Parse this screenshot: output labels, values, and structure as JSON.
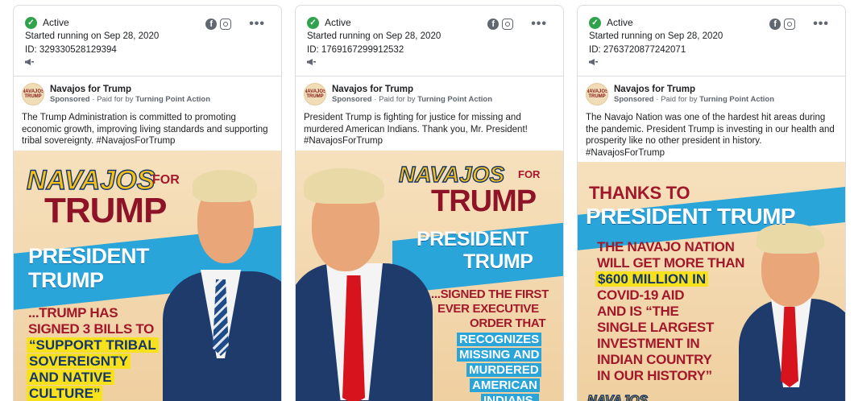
{
  "cards": [
    {
      "status": "Active",
      "started": "Started running on Sep 28, 2020",
      "id": "ID: 329330528129394",
      "page_name": "Navajos for Trump",
      "sponsored": "Sponsored",
      "paid_for_by": "Paid for by",
      "payer": "Turning Point Action",
      "ad_text": "The Trump Administration is committed to promoting economic growth, improving living standards and supporting tribal sovereignty. #NavajosForTrump",
      "creative": {
        "line1": "NAVAJOS",
        "line1b": "FOR",
        "line2": "TRUMP",
        "line3": "PRESIDENT",
        "line4": "TRUMP",
        "line5": "...TRUMP HAS",
        "line6": "SIGNED 3 BILLS TO",
        "line7": "“SUPPORT TRIBAL",
        "line8": "SOVEREIGNTY",
        "line9": "AND NATIVE",
        "line10": "CULTURE”"
      }
    },
    {
      "status": "Active",
      "started": "Started running on Sep 28, 2020",
      "id": "ID: 1769167299912532",
      "page_name": "Navajos for Trump",
      "sponsored": "Sponsored",
      "paid_for_by": "Paid for by",
      "payer": "Turning Point Action",
      "ad_text": "President Trump is fighting for justice for missing and murdered American Indians. Thank you, Mr. President! #NavajosForTrump",
      "creative": {
        "line1": "NAVAJOS",
        "line1b": "FOR",
        "line2": "TRUMP",
        "line3": "PRESIDENT",
        "line4": "TRUMP",
        "line5": "...SIGNED THE FIRST",
        "line6": "EVER EXECUTIVE",
        "line7": "ORDER THAT",
        "line8": "RECOGNIZES",
        "line9": "MISSING AND",
        "line10": "MURDERED",
        "line11": "AMERICAN",
        "line12": "INDIANS."
      }
    },
    {
      "status": "Active",
      "started": "Started running on Sep 28, 2020",
      "id": "ID: 2763720877242071",
      "page_name": "Navajos for Trump",
      "sponsored": "Sponsored",
      "paid_for_by": "Paid for by",
      "payer": "Turning Point Action",
      "ad_text": "The Navajo Nation was one of the hardest hit areas during the pandemic. President Trump is investing in our health and prosperity like no other president in history. #NavajosForTrump",
      "creative": {
        "line1": "THANKS TO",
        "line2": "PRESIDENT TRUMP",
        "line3": "THE NAVAJO NATION",
        "line4": "WILL GET MORE THAN",
        "line5": "$600 MILLION IN",
        "line6": "COVID-19 AID",
        "line7": "AND IS “THE",
        "line8": "SINGLE LARGEST",
        "line9": "INVESTMENT IN",
        "line10": "INDIAN COUNTRY",
        "line11": "IN OUR HISTORY”",
        "line12": "NAVAJOS"
      }
    }
  ],
  "avatar_text": "NAVAJOS TRUMP",
  "icons": {
    "check": "check-circle-icon",
    "facebook": "facebook-icon",
    "instagram": "instagram-icon",
    "more": "more-options-icon",
    "megaphone": "megaphone-icon"
  },
  "colors": {
    "active_green": "#31a24c",
    "banner_blue": "#2aa5da",
    "trump_red": "#8e1327",
    "navajos_yellow": "#f6c21a"
  }
}
